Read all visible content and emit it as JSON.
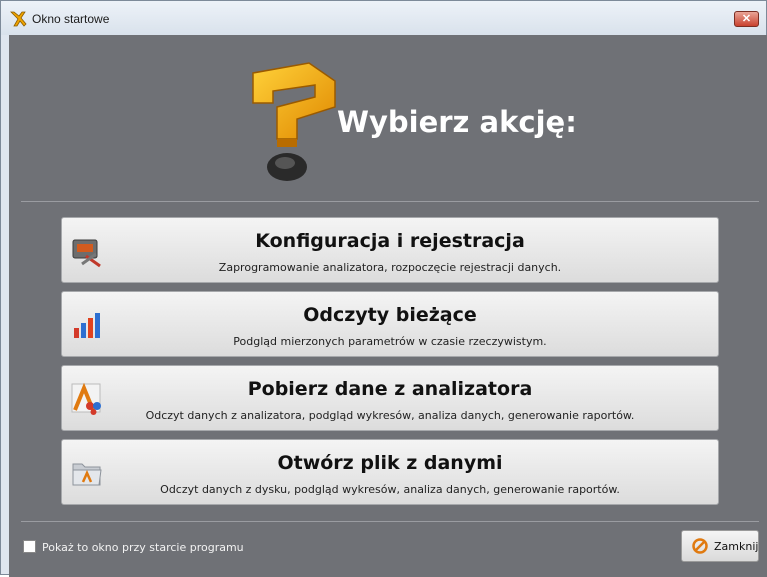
{
  "window": {
    "title": "Okno startowe",
    "close_glyph": "✕"
  },
  "header": {
    "heading": "Wybierz akcję:"
  },
  "actions": [
    {
      "title": "Konfiguracja i rejestracja",
      "description": "Zaprogramowanie analizatora, rozpoczęcie rejestracji danych.",
      "icon": "analyzer-config-icon"
    },
    {
      "title": "Odczyty bieżące",
      "description": "Podgląd mierzonych parametrów w czasie rzeczywistym.",
      "icon": "bar-chart-icon"
    },
    {
      "title": "Pobierz dane z analizatora",
      "description": "Odczyt danych z analizatora, podgląd wykresów, analiza danych, generowanie raportów.",
      "icon": "download-data-icon"
    },
    {
      "title": "Otwórz plik z danymi",
      "description": "Odczyt danych z dysku, podgląd wykresów, analiza danych, generowanie raportów.",
      "icon": "open-folder-icon"
    }
  ],
  "footer": {
    "startup_label": "Pokaż to okno przy starcie programu",
    "startup_checked": false,
    "close_label": "Zamknij"
  },
  "colors": {
    "background": "#6f7176",
    "accent": "#f0a400",
    "close": "#c9412e"
  }
}
